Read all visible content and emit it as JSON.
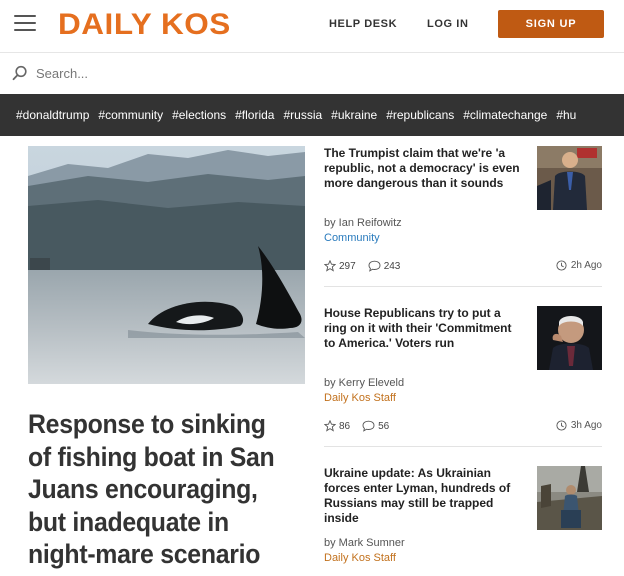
{
  "header": {
    "logo_text": "DAILY KOS",
    "help_desk": "HELP DESK",
    "log_in": "LOG IN",
    "sign_up": "SIGN UP",
    "logo_color": "#e56f1f",
    "signup_color": "#bf5a13"
  },
  "search": {
    "placeholder": "Search..."
  },
  "tags": [
    "#donaldtrump",
    "#community",
    "#elections",
    "#florida",
    "#russia",
    "#ukraine",
    "#republicans",
    "#climatechange",
    "#hu"
  ],
  "hero": {
    "title": "Response to sinking of fishing boat in San Juans encouraging, but inadequate in night-mare scenario"
  },
  "articles": [
    {
      "title": "The Trumpist claim that we're 'a republic, not a democracy' is even more dangerous than it sounds",
      "byline": "by Ian Reifowitz",
      "category": "Community",
      "category_color": "#2a7bbd",
      "likes": "297",
      "comments": "243",
      "time": "2h Ago"
    },
    {
      "title": "House Republicans try to put a ring on it with their 'Commitment to America.' Voters run",
      "byline": "by Kerry Eleveld",
      "category": "Daily Kos Staff",
      "category_color": "#c2711d",
      "likes": "86",
      "comments": "56",
      "time": "3h Ago"
    },
    {
      "title": "Ukraine update: As Ukrainian forces enter Lyman, hundreds of Russians may still be trapped inside",
      "byline": "by Mark Sumner",
      "category": "Daily Kos Staff",
      "category_color": "#c2711d"
    }
  ]
}
